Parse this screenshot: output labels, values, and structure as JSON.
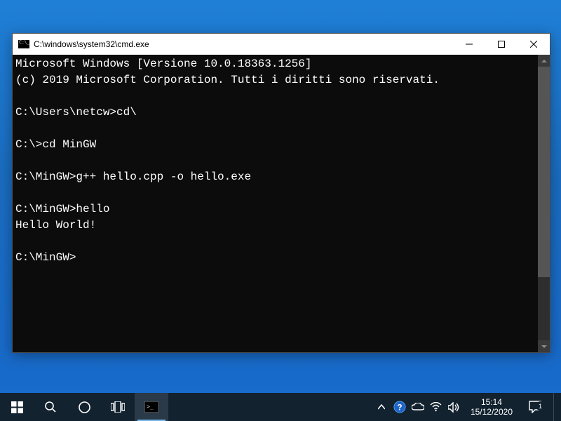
{
  "window": {
    "title": "C:\\windows\\system32\\cmd.exe"
  },
  "terminal": {
    "lines": [
      "Microsoft Windows [Versione 10.0.18363.1256]",
      "(c) 2019 Microsoft Corporation. Tutti i diritti sono riservati.",
      "",
      "C:\\Users\\netcw>cd\\",
      "",
      "C:\\>cd MinGW",
      "",
      "C:\\MinGW>g++ hello.cpp -o hello.exe",
      "",
      "C:\\MinGW>hello",
      "Hello World!",
      "",
      "C:\\MinGW>"
    ]
  },
  "taskbar": {
    "clock_time": "15:14",
    "clock_date": "15/12/2020",
    "notification_count": "1"
  },
  "colors": {
    "terminal_bg": "#0c0c0c",
    "terminal_fg": "#ffffff",
    "taskbar_bg": "#13222f",
    "desktop_bg": "#1a6fc4"
  }
}
